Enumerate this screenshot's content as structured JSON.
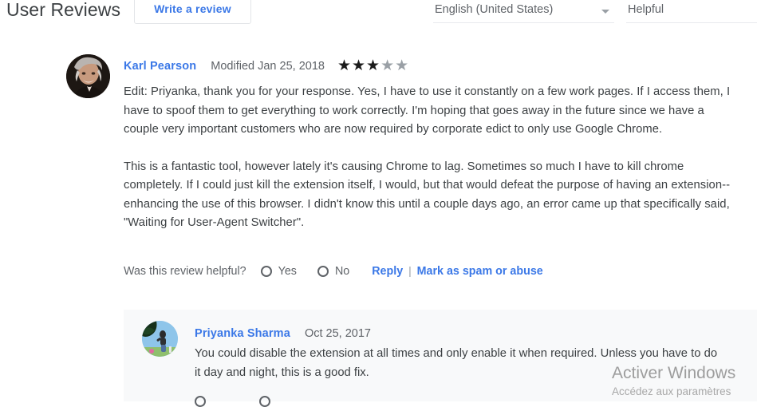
{
  "header": {
    "page_title": "User Reviews",
    "write_review_label": "Write a review",
    "language_select": {
      "value": "English (United States)",
      "caret": "chevron-down-icon"
    },
    "sort_select": {
      "value": "Helpful"
    }
  },
  "review": {
    "author": "Karl Pearson",
    "date": "Modified Jan 25, 2018",
    "rating": 3,
    "rating_max": 5,
    "star_filled_glyph": "★",
    "star_empty_glyph": "★",
    "paragraphs": [
      "Edit: Priyanka, thank you for your response. Yes, I have to use it constantly on a few work pages. If I access them, I have to spoof them to get everything to work correctly. I'm hoping that goes away in the future since we have a couple very important customers who are now required by corporate edict to only use Google Chrome.",
      "This is a fantastic tool, however lately it's causing Chrome to lag. Sometimes so much I have to kill chrome completely. If I could just kill the extension itself, I would, but that would defeat the purpose of having an extension--enhancing the use of this browser. I didn't know this until a couple days ago, an error came up that specifically said, \"Waiting for User-Agent Switcher\"."
    ],
    "helpful_question": "Was this review helpful?",
    "yes_label": "Yes",
    "no_label": "No",
    "reply_label": "Reply",
    "separator": "|",
    "spam_label": "Mark as spam or abuse"
  },
  "reply": {
    "author": "Priyanka Sharma",
    "date": "Oct 25, 2017",
    "text": "You could disable the extension at all times and only enable it when required. Unless you have to do it day and night, this is a good fix."
  },
  "watermark": {
    "title": "Activer Windows",
    "subtitle": "Accédez aux paramètres"
  },
  "colors": {
    "link_blue": "#3b78e7",
    "text_gray": "#5f6368",
    "body_text": "#3c4043",
    "reply_bg": "#f8f9fa",
    "star_on": "#1b1b1b",
    "star_off": "#9aa0a6"
  }
}
